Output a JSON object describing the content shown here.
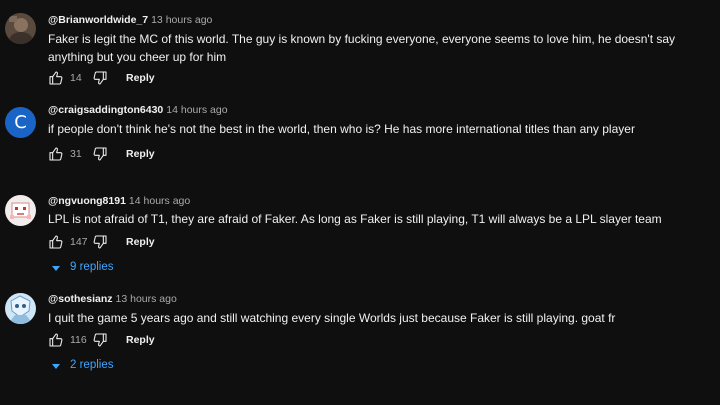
{
  "comments": [
    {
      "author": "@Brianworldwide_7",
      "time": "13 hours ago",
      "text": "Faker is legit the MC of this world. The guy is known by fucking everyone, everyone seems to love him, he doesn't say anything but you cheer up for him",
      "likes": "14",
      "reply_label": "Reply",
      "avatar": "photo-avatar"
    },
    {
      "author": "@craigsaddington6430",
      "time": "14 hours ago",
      "text": "if people don't think he's not the best in the world, then who is? He has more international titles than any player",
      "likes": "31",
      "reply_label": "Reply",
      "avatar_letter": "C",
      "avatar_color": "#1a63c7"
    },
    {
      "author": "@ngvuong8191",
      "time": "14 hours ago",
      "text": "LPL is not afraid of T1, they are afraid of Faker. As long as Faker is still playing, T1 will always be a LPL slayer team",
      "likes": "147",
      "reply_label": "Reply",
      "replies_label": "9 replies",
      "avatar": "pixel-avatar"
    },
    {
      "author": "@sothesianz",
      "time": "13 hours ago",
      "text": "I quit the game 5 years ago and still watching every single Worlds just because Faker is still playing. goat fr",
      "likes": "116",
      "reply_label": "Reply",
      "replies_label": "2 replies",
      "avatar": "anime-avatar"
    }
  ],
  "colors": {
    "background": "#0f0f0f",
    "text": "#f1f1f1",
    "secondary": "#aaaaaa",
    "link": "#3ea6ff"
  },
  "icons": [
    "thumbs-up-icon",
    "thumbs-down-icon",
    "caret-down-icon"
  ]
}
